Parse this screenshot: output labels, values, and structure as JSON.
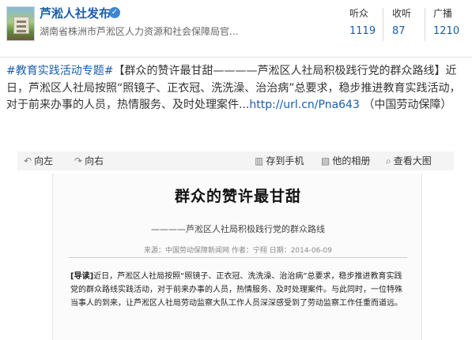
{
  "account": {
    "name": "芦淞人社发布",
    "verified_icon": "verified-badge-icon",
    "description": "湖南省株洲市芦淞区人力资源和社会保障局官..."
  },
  "stats": [
    {
      "label": "听众",
      "value": "1119"
    },
    {
      "label": "收听",
      "value": "87"
    },
    {
      "label": "广播",
      "value": "1210"
    }
  ],
  "post": {
    "hashtag": "#教育实践活动专题#",
    "text": "【群众的赞许最甘甜————芦淞区人社局积极践行党的群众路线】近日，芦淞区人社局按照“照镜子、正衣冠、洗洗澡、治治病”总要求，稳步推进教育实践活动，对于前来办事的人员，热情服务、及时处理案件...",
    "link": "http://url.cn/Pna643",
    "source": "（中国劳动保障）"
  },
  "toolbar": {
    "rotate_left": "向左",
    "rotate_right": "向右",
    "save_to_phone": "存到手机",
    "album": "他的相册",
    "view_large": "查看大图"
  },
  "article": {
    "title": "群众的赞许最甘甜",
    "subtitle": "————芦淞区人社局积极践行党的群众路线",
    "meta": "来源：中国劳动保障新闻网   作者：宁翔   日期：2014-06-09",
    "lead": "[导读]",
    "body": "近日，芦淞区人社局按照“照镜子、正衣冠、洗洗澡、治治病”总要求，稳步推进教育实践党的群众路线实践活动，对于前来办事的人员，热情服务、及时处理案件。与此同时，一位特殊当事人的到来，让芦淞区人社局劳动监察大队工作人员深深感受到了劳动监察工作任重而道远。"
  },
  "colors": {
    "link": "#1a5ea8",
    "text": "#333333",
    "toolbar_bg": "#f4f4f4"
  }
}
